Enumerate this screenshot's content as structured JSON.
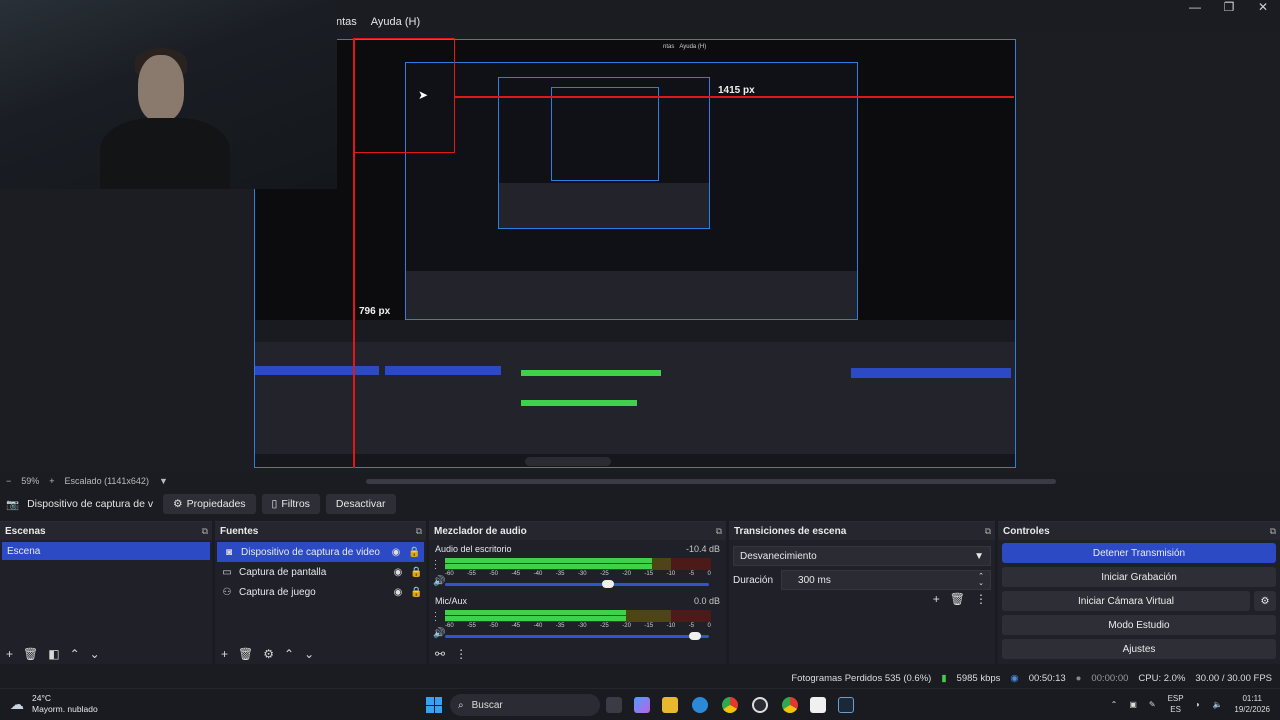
{
  "window": {
    "minimize": "—",
    "maximize": "❐",
    "close": "✕"
  },
  "menubar": {
    "items": [
      "ntas",
      "Ayuda (H)"
    ]
  },
  "preview": {
    "measure_h": "1415 px",
    "measure_v": "796 px",
    "nested_menu": [
      "ntas",
      "Ayuda (H)"
    ]
  },
  "scale": {
    "minus": "−",
    "zoom": "59%",
    "plus": "+",
    "mode": "Escalado (1141x642)"
  },
  "source_toolbar": {
    "source_name": "Dispositivo de captura de v",
    "properties": "Propiedades",
    "filters": "Filtros",
    "deactivate": "Desactivar"
  },
  "scenes": {
    "title": "Escenas",
    "items": [
      "Escena"
    ]
  },
  "sources": {
    "title": "Fuentes",
    "items": [
      {
        "name": "Dispositivo de captura de video",
        "icon": "camera-icon"
      },
      {
        "name": "Captura de pantalla",
        "icon": "monitor-icon"
      },
      {
        "name": "Captura de juego",
        "icon": "gamepad-icon"
      }
    ]
  },
  "mixer": {
    "title": "Mezclador de audio",
    "channels": [
      {
        "name": "Audio del escritorio",
        "db": "-10.4 dB",
        "level": 0.78,
        "volume": 0.64
      },
      {
        "name": "Mic/Aux",
        "db": "0.0 dB",
        "level": 0.68,
        "volume": 0.97
      }
    ],
    "ticks": [
      "-60",
      "-55",
      "-50",
      "-45",
      "-40",
      "-35",
      "-30",
      "-25",
      "-20",
      "-15",
      "-10",
      "-5",
      "0"
    ]
  },
  "transitions": {
    "title": "Transiciones de escena",
    "selected": "Desvanecimiento",
    "duration_label": "Duración",
    "duration_value": "300 ms"
  },
  "controls": {
    "title": "Controles",
    "stop_stream": "Detener Transmisión",
    "start_recording": "Iniciar Grabación",
    "start_virtual_cam": "Iniciar Cámara Virtual",
    "studio_mode": "Modo Estudio",
    "settings": "Ajustes"
  },
  "status": {
    "dropped": "Fotogramas Perdidos 535 (0.6%)",
    "bitrate": "5985 kbps",
    "stream_time": "00:50:13",
    "rec_time": "00:00:00",
    "cpu": "CPU: 2.0%",
    "fps": "30.00 / 30.00 FPS"
  },
  "taskbar": {
    "temp": "24°C",
    "weather": "Mayorm. nublado",
    "search": "Buscar",
    "lang1": "ESP",
    "lang2": "ES",
    "time": "01:11",
    "date": "19/2/2026"
  },
  "colors": {
    "accent": "#2c4ac4",
    "preview_border": "#2f7de0",
    "measure": "#e01818",
    "meter_green": "#3fd14a"
  }
}
